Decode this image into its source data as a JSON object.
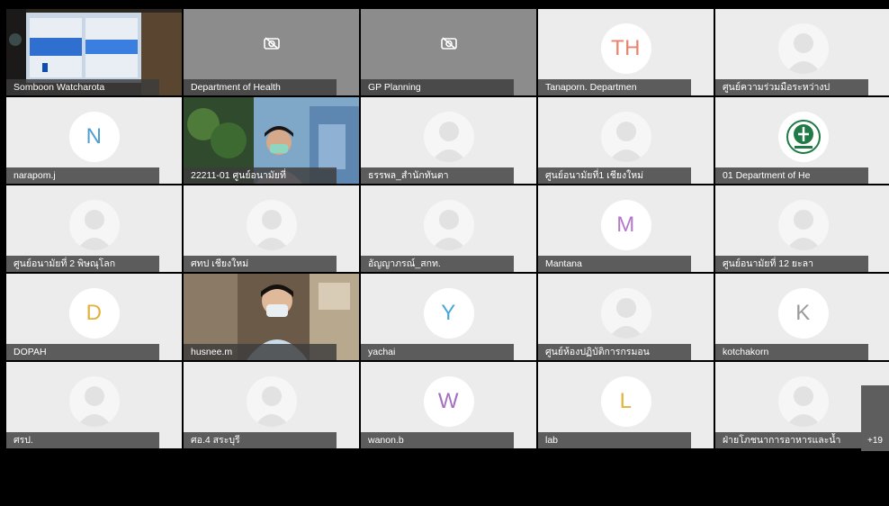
{
  "participants": [
    {
      "name": "Somboon Watcharota",
      "kind": "video-room"
    },
    {
      "name": "Department of Health",
      "kind": "camoff"
    },
    {
      "name": "GP Planning",
      "kind": "camoff"
    },
    {
      "name": "Tanaporn. Departmen",
      "kind": "initials",
      "initials": "TH",
      "color": "#e8836e"
    },
    {
      "name": "ศูนย์ความร่วมมือระหว่างป",
      "kind": "silhouette"
    },
    {
      "name": "narapom.j",
      "kind": "initials",
      "initials": "N",
      "color": "#4f9fd0"
    },
    {
      "name": "22211-01 ศูนย์อนามัยที่",
      "kind": "video-person"
    },
    {
      "name": "ธรรพล_สำนักทันตา",
      "kind": "silhouette"
    },
    {
      "name": "ศูนย์อนามัยที่1 เชียงใหม่",
      "kind": "silhouette"
    },
    {
      "name": "01 Department of He",
      "kind": "logo"
    },
    {
      "name": "ศูนย์อนามัยที่ 2 พิษณุโลก",
      "kind": "silhouette"
    },
    {
      "name": "ศทป เชียงใหม่",
      "kind": "silhouette"
    },
    {
      "name": "อัญญาภรณ์_สกท.",
      "kind": "silhouette"
    },
    {
      "name": "Mantana",
      "kind": "initials",
      "initials": "M",
      "color": "#b478c8"
    },
    {
      "name": "ศูนย์อนามัยที่ 12 ยะลา",
      "kind": "silhouette"
    },
    {
      "name": "DOPAH",
      "kind": "initials",
      "initials": "D",
      "color": "#e2b23c"
    },
    {
      "name": "husnee.m",
      "kind": "video-person2"
    },
    {
      "name": "yachai",
      "kind": "initials",
      "initials": "Y",
      "color": "#4aa5d8"
    },
    {
      "name": "ศูนย์ห้องปฏิบัติการกรมอน",
      "kind": "silhouette"
    },
    {
      "name": "kotchakorn",
      "kind": "initials",
      "initials": "K",
      "color": "#9a9a9a"
    },
    {
      "name": "ศรป.",
      "kind": "silhouette"
    },
    {
      "name": "ศอ.4 สระบุรี",
      "kind": "silhouette"
    },
    {
      "name": "wanon.b",
      "kind": "initials",
      "initials": "W",
      "color": "#a56fbf"
    },
    {
      "name": "lab",
      "kind": "initials",
      "initials": "L",
      "color": "#e6b23a"
    },
    {
      "name": "ฝ่ายโภชนาการอาหารและน้ำ",
      "kind": "silhouette"
    }
  ],
  "overflow": {
    "label": "+19"
  }
}
